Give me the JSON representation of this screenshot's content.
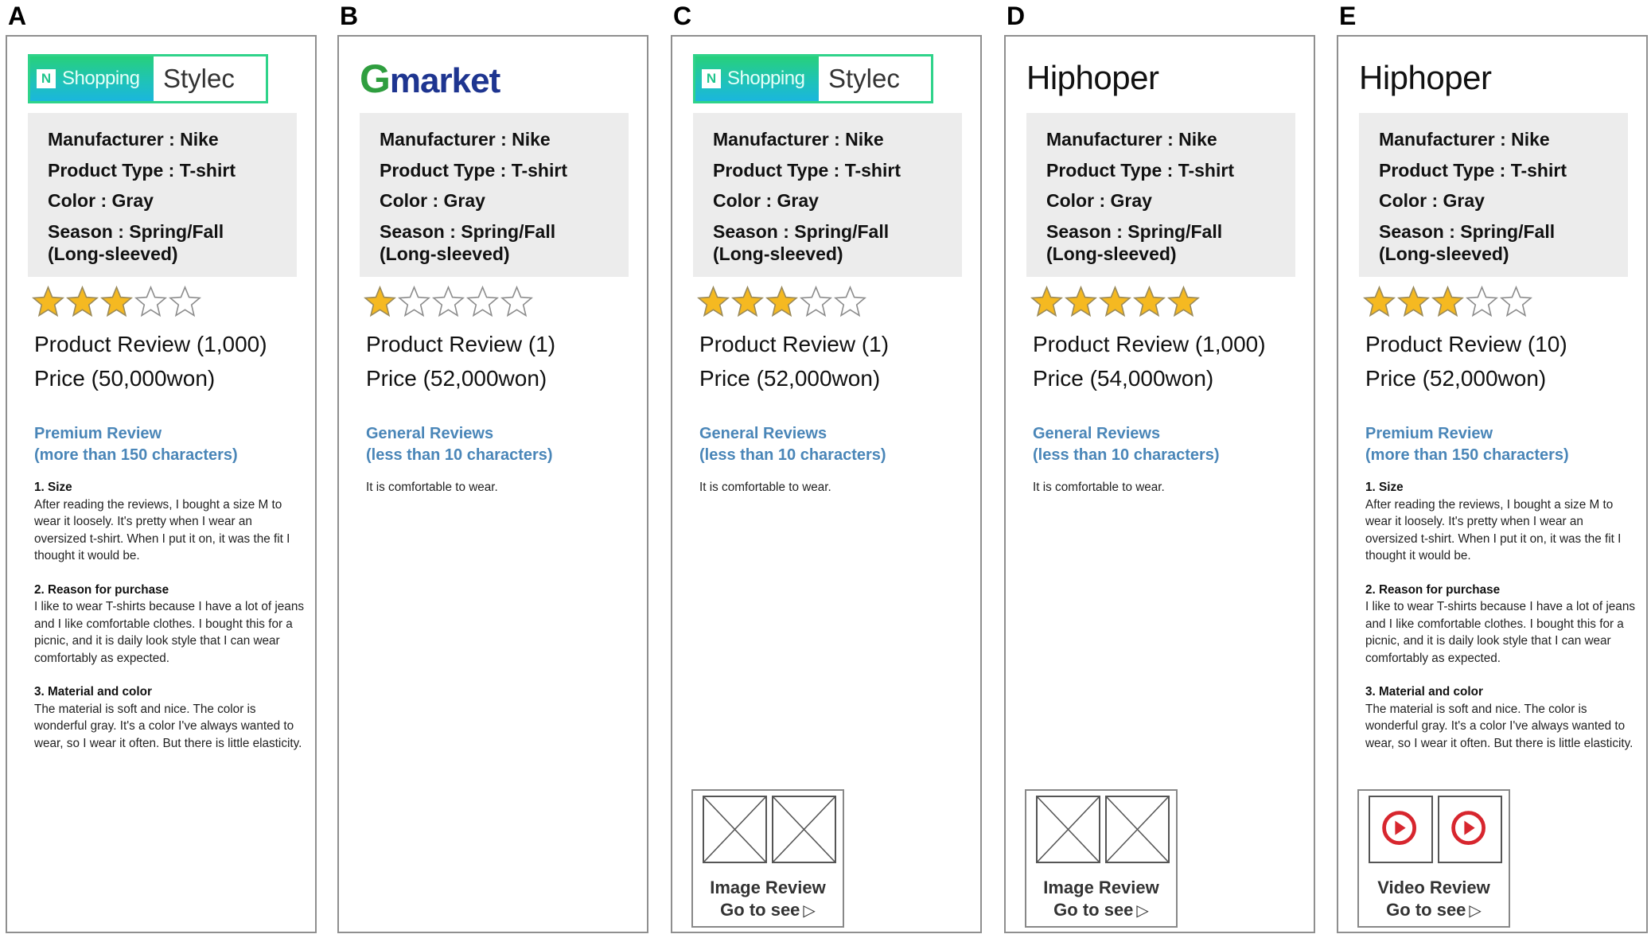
{
  "colors": {
    "star_fill": "#f5b921",
    "star_stroke_filled": "#9a8a5a",
    "star_stroke_empty": "#8c8c8c",
    "review_type_text": "#4a86b8",
    "spec_box_bg": "#ececec",
    "video_play": "#d7262e"
  },
  "panels": [
    {
      "letter": "A",
      "logo": {
        "type": "nshopping",
        "n_glyph": "N",
        "left_text": "Shopping",
        "right_text": "Stylec"
      },
      "specs": {
        "manufacturer": "Manufacturer : Nike",
        "product_type": "Product Type : T-shirt",
        "color": "Color : Gray",
        "season": "Season : Spring/Fall",
        "season_note": "(Long-sleeved)"
      },
      "rating": 3,
      "rating_max": 5,
      "review_count": "Product Review (1,000)",
      "price": "Price (50,000won)",
      "review_type": {
        "line1": "Premium Review",
        "line2": "(more than 150 characters)"
      },
      "review_sections": [
        {
          "title": "1. Size",
          "text": "After reading the reviews, I bought a size M to wear it loosely. It's pretty when I wear an oversized t-shirt. When I put it on, it was the fit I thought it would be."
        },
        {
          "title": "2. Reason for purchase",
          "text": "I like to wear T-shirts because I have a lot of jeans and I like comfortable clothes. I bought this for a picnic, and it is daily look style that I can wear comfortably as expected."
        },
        {
          "title": "3. Material and color",
          "text": "The material is soft and nice. The color is wonderful gray. It's a color I've always wanted to wear, so I wear it often. But there is little elasticity."
        }
      ],
      "media": null
    },
    {
      "letter": "B",
      "logo": {
        "type": "gmarket",
        "g_text": "G",
        "rest_text": "market"
      },
      "specs": {
        "manufacturer": "Manufacturer : Nike",
        "product_type": "Product Type : T-shirt",
        "color": "Color : Gray",
        "season": "Season : Spring/Fall",
        "season_note": "(Long-sleeved)"
      },
      "rating": 1,
      "rating_max": 5,
      "review_count": "Product Review (1)",
      "price": "Price (52,000won)",
      "review_type": {
        "line1": "General Reviews",
        "line2": "(less than 10 characters)"
      },
      "general_text": "It is comfortable to wear.",
      "media": null
    },
    {
      "letter": "C",
      "logo": {
        "type": "nshopping",
        "n_glyph": "N",
        "left_text": "Shopping",
        "right_text": "Stylec"
      },
      "specs": {
        "manufacturer": "Manufacturer : Nike",
        "product_type": "Product Type : T-shirt",
        "color": "Color : Gray",
        "season": "Season : Spring/Fall",
        "season_note": "(Long-sleeved)"
      },
      "rating": 3,
      "rating_max": 5,
      "review_count": "Product Review (1)",
      "price": "Price (52,000won)",
      "review_type": {
        "line1": "General Reviews",
        "line2": "(less than 10 characters)"
      },
      "general_text": "It is comfortable to wear.",
      "media": {
        "kind": "image",
        "label_line1": "Image Review",
        "label_line2": "Go to see",
        "arrow": "▷",
        "thumb_icon": "image-placeholder-icon"
      }
    },
    {
      "letter": "D",
      "logo": {
        "type": "text",
        "text": "Hiphoper"
      },
      "specs": {
        "manufacturer": "Manufacturer : Nike",
        "product_type": "Product Type : T-shirt",
        "color": "Color : Gray",
        "season": "Season : Spring/Fall",
        "season_note": "(Long-sleeved)"
      },
      "rating": 5,
      "rating_max": 5,
      "review_count": "Product Review (1,000)",
      "price": "Price (54,000won)",
      "review_type": {
        "line1": "General Reviews",
        "line2": "(less than 10 characters)"
      },
      "general_text": "It is comfortable to wear.",
      "media": {
        "kind": "image",
        "label_line1": "Image Review",
        "label_line2": "Go to see",
        "arrow": "▷",
        "thumb_icon": "image-placeholder-icon"
      }
    },
    {
      "letter": "E",
      "logo": {
        "type": "text",
        "text": "Hiphoper"
      },
      "specs": {
        "manufacturer": "Manufacturer : Nike",
        "product_type": "Product Type : T-shirt",
        "color": "Color : Gray",
        "season": "Season : Spring/Fall",
        "season_note": "(Long-sleeved)"
      },
      "rating": 3,
      "rating_max": 5,
      "review_count": "Product Review (10)",
      "price": "Price (52,000won)",
      "review_type": {
        "line1": "Premium Review",
        "line2": "(more than 150 characters)"
      },
      "review_sections": [
        {
          "title": "1. Size",
          "text": "After reading the reviews, I bought a size M to wear it loosely. It's pretty when I wear an oversized t-shirt. When I put it on, it was the fit I thought it would be."
        },
        {
          "title": "2. Reason for purchase",
          "text": "I like to wear T-shirts because I have a lot of jeans and I like comfortable clothes. I bought this for a picnic, and it is daily look style that I can wear comfortably as expected."
        },
        {
          "title": "3. Material and color",
          "text": "The material is soft and nice. The color is wonderful gray. It's a color I've always wanted to wear, so I wear it often. But there is little elasticity."
        }
      ],
      "media": {
        "kind": "video",
        "label_line1": "Video Review",
        "label_line2": "Go to see",
        "arrow": "▷",
        "thumb_icon": "play-button-icon"
      }
    }
  ]
}
